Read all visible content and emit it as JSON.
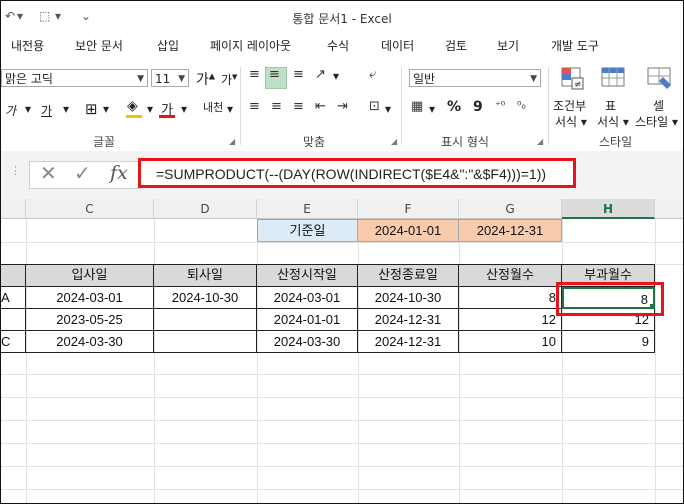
{
  "window": {
    "title": "통합 문서1 - Excel"
  },
  "menu": [
    "내전용",
    "보안 문서",
    "삽입",
    "페이지 레이아웃",
    "수식",
    "데이터",
    "검토",
    "보기",
    "개발 도구"
  ],
  "ribbon": {
    "font_name": "맑은 고딕",
    "font_size": "11",
    "grow_font": "가",
    "shrink_font": "가",
    "italic": "가",
    "underline": "가",
    "font_color_glyph": "가",
    "phonetic": "내천",
    "number_format": "일반",
    "percent": "%",
    "comma": "9",
    "cond_format": [
      "조건부",
      "서식"
    ],
    "table_format": [
      "표",
      "서식"
    ],
    "cell_style": [
      "셀",
      "스타일"
    ],
    "groups": [
      "글꼴",
      "맞춤",
      "표시 형식",
      "스타일"
    ],
    "colors": {
      "highlight": "#f5c400",
      "font_color": "#e8141c"
    }
  },
  "formula_bar": {
    "formula": "=SUMPRODUCT(--(DAY(ROW(INDIRECT($E4&\":\"&$F4)))=1))"
  },
  "columns": [
    "C",
    "D",
    "E",
    "F",
    "G",
    "H"
  ],
  "top": {
    "label": "기준일",
    "start": "2024-01-01",
    "end": "2024-12-31"
  },
  "table": {
    "headers": [
      "입사일",
      "퇴사일",
      "산정시작일",
      "산정종료일",
      "산정월수",
      "부과월수"
    ],
    "rows": [
      [
        "2024-03-01",
        "2024-10-30",
        "2024-03-01",
        "2024-10-30",
        "8",
        "8"
      ],
      [
        "2023-05-25",
        "",
        "2024-01-01",
        "2024-12-31",
        "12",
        "12"
      ],
      [
        "2024-03-30",
        "",
        "2024-03-30",
        "2024-12-31",
        "10",
        "9"
      ]
    ],
    "rowstub": [
      "A",
      "",
      "C"
    ]
  }
}
